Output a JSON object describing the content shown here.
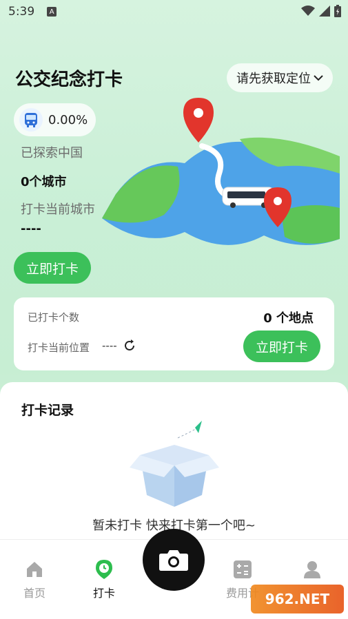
{
  "status": {
    "time": "5:39"
  },
  "header": {
    "title": "公交纪念打卡",
    "location_button": "请先获取定位"
  },
  "summary": {
    "percent": "0.00%",
    "explored_label": "已探索中国",
    "cities": "0个城市",
    "current_city_label": "打卡当前城市",
    "current_city_value": "----",
    "checkin_button": "立即打卡"
  },
  "stats": {
    "count_label": "已打卡个数",
    "count_value": "0 个地点",
    "location_label": "打卡当前位置",
    "location_value": "----",
    "checkin_button": "立即打卡"
  },
  "records": {
    "title": "打卡记录",
    "empty_text": "暂未打卡 快来打卡第一个吧~"
  },
  "tabs": [
    {
      "label": "首页"
    },
    {
      "label": "打卡"
    },
    {
      "label": "费用计"
    }
  ],
  "watermark": "962.NET",
  "colors": {
    "accent": "#3cc05a",
    "text": "#111111",
    "muted": "#6b6b6b"
  }
}
